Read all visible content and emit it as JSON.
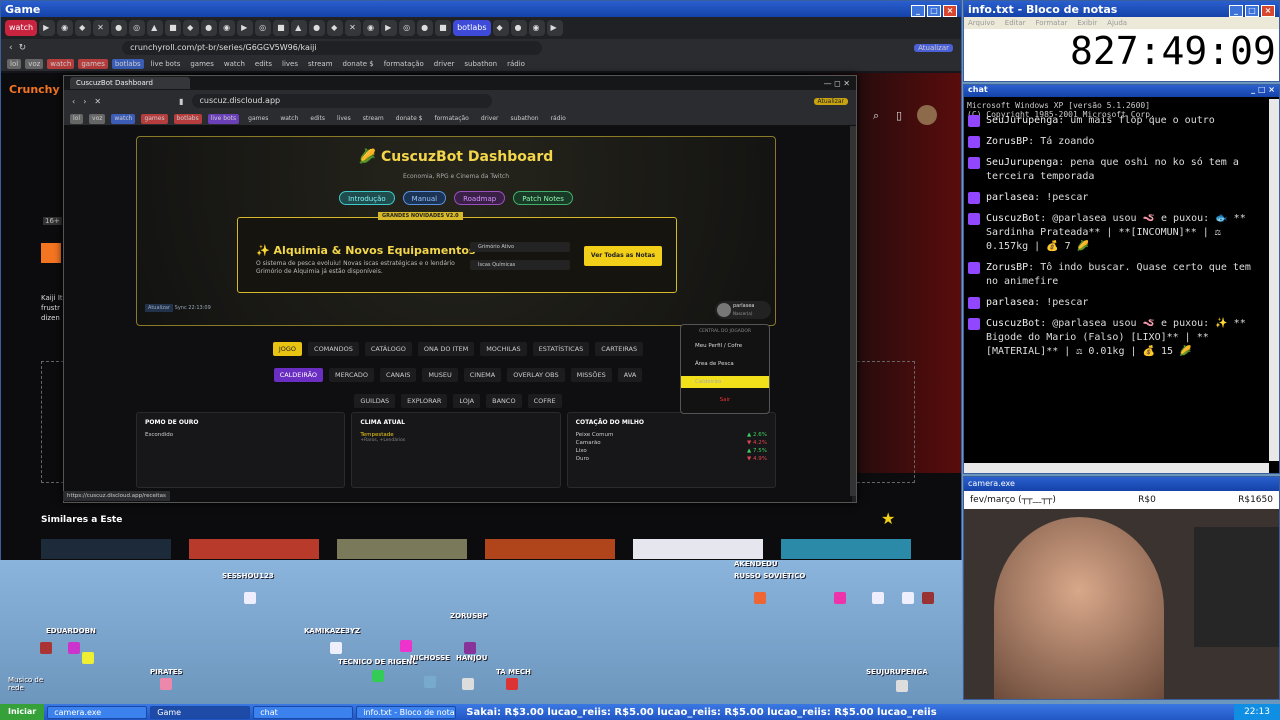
{
  "game_window": {
    "title": "Game",
    "tabs": [
      "watch",
      "botlabs"
    ],
    "url": "crunchyroll.com/pt-br/series/G6GGV5W96/kaiji",
    "update_label": "Atualizar",
    "bookmarks": [
      "lol",
      "voz",
      "watch",
      "games",
      "botlabs",
      "live bots",
      "games",
      "watch",
      "edits",
      "lives",
      "stream",
      "donate $",
      "formatação",
      "driver",
      "subathon",
      "rádio"
    ]
  },
  "inner_browser": {
    "tab_title": "CuscuzBot Dashboard",
    "url": "cuscuz.discloud.app",
    "update_label": "Atualizar",
    "status_url": "https://cuscuz.discloud.app/receitas"
  },
  "dashboard": {
    "title": "CuscuzBot Dashboard",
    "subtitle": "Economia, RPG e Cinema da Twitch",
    "buttons": [
      "Introdução",
      "Manual",
      "Roadmap",
      "Patch Notes"
    ],
    "news": {
      "badge": "GRANDES NOVIDADES V2.0",
      "title": "Alquimia & Novos Equipamentos",
      "desc": "O sistema de pesca evoluiu! Novas iscas estratégicas e o lendário Grimório de Alquimia já estão disponíveis.",
      "chips": [
        "Grimório Ativo",
        "Iscas Químicas"
      ],
      "cta": "Ver Todas as Notas"
    },
    "small_left": "Atualizar",
    "small_sync": "Sync 22:13:09",
    "user": {
      "name": "parlasea",
      "role": "Nascer(a)"
    },
    "nav_row1": [
      "JOGO",
      "COMANDOS",
      "CATÁLOGO",
      "ONA DO ITEM",
      "MOCHILAS",
      "ESTATÍSTICAS",
      "CARTEIRAS"
    ],
    "nav_row2": [
      "CALDEIRÃO",
      "MERCADO",
      "CANAIS",
      "MUSEU",
      "CINEMA",
      "OVERLAY OBS",
      "MISSÕES",
      "AVA"
    ],
    "nav_row3": [
      "GUILDAS",
      "EXPLORAR",
      "LOJA",
      "BANCO",
      "COFRE"
    ],
    "menu": {
      "header": "CENTRAL DO JOGADOR",
      "items": [
        "Meu Perfil / Cofre",
        "Área de Pesca",
        "Caldeirão"
      ],
      "exit": "Sair"
    },
    "cards": {
      "pomo": {
        "title": "POMO DE OURO",
        "value": "Escondido"
      },
      "clima": {
        "title": "CLIMA ATUAL",
        "value": "Tempestade",
        "sub": "+Raros, +Lendários"
      },
      "cotacao": {
        "title": "COTAÇÃO DO MILHO",
        "rows": [
          {
            "name": "Peixe Comum",
            "delta": "▲ 2.6%",
            "dir": "up"
          },
          {
            "name": "Camarão",
            "delta": "▼ 4.2%",
            "dir": "down"
          },
          {
            "name": "Lixo",
            "delta": "▲ 7.5%",
            "dir": "up"
          },
          {
            "name": "Ouro",
            "delta": "▼ 4.9%",
            "dir": "down"
          }
        ]
      }
    }
  },
  "crunchyroll": {
    "logo": "Crunchy",
    "similar": "Similares a Este",
    "age": "16+",
    "desc": "Kaiji It frustr dizen"
  },
  "notepad": {
    "title": "info.txt - Bloco de notas",
    "menu": [
      "Arquivo",
      "Editar",
      "Formatar",
      "Exibir",
      "Ajuda"
    ],
    "timer": "827:49:09"
  },
  "chat": {
    "title": "chat",
    "header_lines": [
      "Microsoft Windows XP [versão 5.1.2600]",
      "(C) Copyright 1985-2001 Microsoft Corp."
    ],
    "messages": [
      {
        "user": "SeuJurupenga",
        "text": "um mais flop que o outro"
      },
      {
        "user": "ZorusBP",
        "text": "Tá zoando"
      },
      {
        "user": "SeuJurupenga",
        "text": "pena que oshi no ko só tem a terceira temporada"
      },
      {
        "user": "parlasea",
        "text": "!pescar"
      },
      {
        "user": "CuscuzBot",
        "text": "@parlasea usou 🪱 e puxou: 🐟 ** Sardinha Prateada** | **[INCOMUN]** | ⚖ 0.157kg | 💰 7 🌽"
      },
      {
        "user": "ZorusBP",
        "text": "Tô indo buscar. Quase certo que tem no animefire"
      },
      {
        "user": "parlasea",
        "text": "!pescar"
      },
      {
        "user": "CuscuzBot",
        "text": "@parlasea usou 🪱 e puxou: ✨ ** Bigode do Mario (Falso) [LIXO]** | **[MATERIAL]** | ⚖ 0.01kg | 💰 15 🌽"
      }
    ]
  },
  "camera": {
    "title": "camera.exe",
    "left": "fev/março (┬┬﹏┬┬)",
    "mid": "R$0",
    "right": "R$1650"
  },
  "stream_users": [
    "SESSHOU123",
    "EDUARDOBN",
    "KAMIKAZE3YZ",
    "ZORUSBP",
    "PIRATES",
    "TECNICO DE RIGENC",
    "NICHOSSE",
    "HANJOU",
    "TA MECH",
    "AKENDEDU",
    "RUSSO SOVIÉTICO",
    "SEUJURUPENGA",
    "Musico de rede"
  ],
  "taskbar": {
    "start": "Iniciar",
    "tasks": [
      "camera.exe",
      "Game",
      "chat",
      "info.txt - Bloco de notas"
    ],
    "ticker": "Sakai: R$3.00  lucao_reiis: R$5.00  lucao_reiis: R$5.00  lucao_reiis: R$5.00  lucao_reiis",
    "clock": "22:13"
  },
  "colors": {
    "accent": "#f2cf18",
    "twitch": "#9147ff"
  }
}
